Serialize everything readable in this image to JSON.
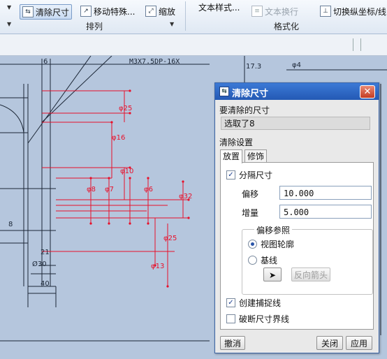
{
  "ribbon": {
    "clear_dim_label": "清除尺寸",
    "move_special_label": "移动特殊...",
    "zoom_label": "缩放",
    "text_style_label": "文本样式...",
    "text_wrap_label": "文本换行",
    "toggle_ordinate_label": "切换纵坐标/线",
    "group_arrange_label": "排列",
    "group_format_label": "格式化",
    "icons": [
      "clear-dimension-icon",
      "move-special-icon",
      "zoom-icon",
      "text-wrap-icon",
      "toggle-ordinate-icon"
    ]
  },
  "drawing": {
    "note_text": "M3X7.5DP-16X",
    "dims": [
      "6",
      "17.3",
      "φ4",
      "8",
      "21",
      "Ø30",
      "40",
      "φ25",
      "φ16",
      "φ10",
      "φ8",
      "φ7",
      "φ6",
      "φ32",
      "φ25",
      "φ13"
    ]
  },
  "dialog": {
    "title": "清除尺寸",
    "dims_to_clear_label": "要清除的尺寸",
    "selected_text": "选取了8",
    "settings_label": "清除设置",
    "tab_placement": "放置",
    "tab_cosmetic": "修饰",
    "separate_dims_label": "分隔尺寸",
    "offset_label": "偏移",
    "offset_value": "10.000",
    "increment_label": "增量",
    "increment_value": "5.000",
    "offset_ref_legend": "偏移参照",
    "radio_view_outline": "视图轮廓",
    "radio_baseline": "基线",
    "reverse_arrow_label": "反向箭头",
    "create_snap_lines_label": "创建捕捉线",
    "break_witness_lines_label": "破断尺寸界线",
    "undo_label": "撤消",
    "close_label": "关闭",
    "apply_label": "应用"
  },
  "colors": {
    "accent": "#2459b4",
    "dim_red": "#e8102a",
    "canvas": "#b5c6dd"
  }
}
